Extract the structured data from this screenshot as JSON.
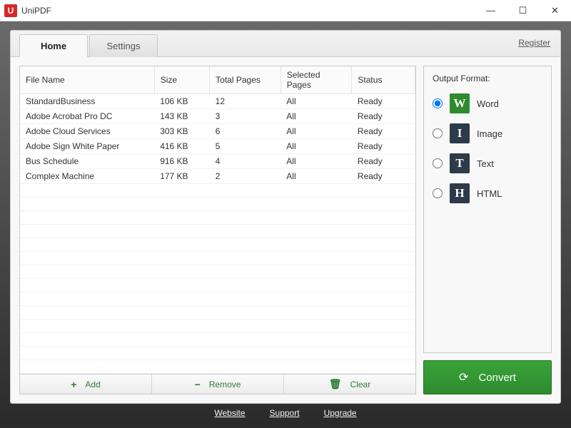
{
  "window": {
    "title": "UniPDF",
    "icon_letter": "U"
  },
  "tabs": {
    "home": "Home",
    "settings": "Settings"
  },
  "register": "Register",
  "columns": {
    "name": "File Name",
    "size": "Size",
    "total": "Total Pages",
    "selected": "Selected Pages",
    "status": "Status"
  },
  "files": [
    {
      "name": "StandardBusiness",
      "size": "106 KB",
      "total": "12",
      "selected": "All",
      "status": "Ready"
    },
    {
      "name": "Adobe Acrobat Pro DC",
      "size": "143 KB",
      "total": "3",
      "selected": "All",
      "status": "Ready"
    },
    {
      "name": "Adobe Cloud Services",
      "size": "303 KB",
      "total": "6",
      "selected": "All",
      "status": "Ready"
    },
    {
      "name": "Adobe Sign White Paper",
      "size": "416 KB",
      "total": "5",
      "selected": "All",
      "status": "Ready"
    },
    {
      "name": "Bus Schedule",
      "size": "916 KB",
      "total": "4",
      "selected": "All",
      "status": "Ready"
    },
    {
      "name": "Complex Machine",
      "size": "177 KB",
      "total": "2",
      "selected": "All",
      "status": "Ready"
    }
  ],
  "filebar": {
    "add": "Add",
    "remove": "Remove",
    "clear": "Clear"
  },
  "output": {
    "label": "Output Format:",
    "options": {
      "word": "Word",
      "image": "Image",
      "text": "Text",
      "html": "HTML"
    },
    "selected": "word",
    "badges": {
      "word": "W",
      "image": "I",
      "text": "T",
      "html": "H"
    }
  },
  "convert": "Convert",
  "footer": {
    "website": "Website",
    "support": "Support",
    "upgrade": "Upgrade"
  }
}
